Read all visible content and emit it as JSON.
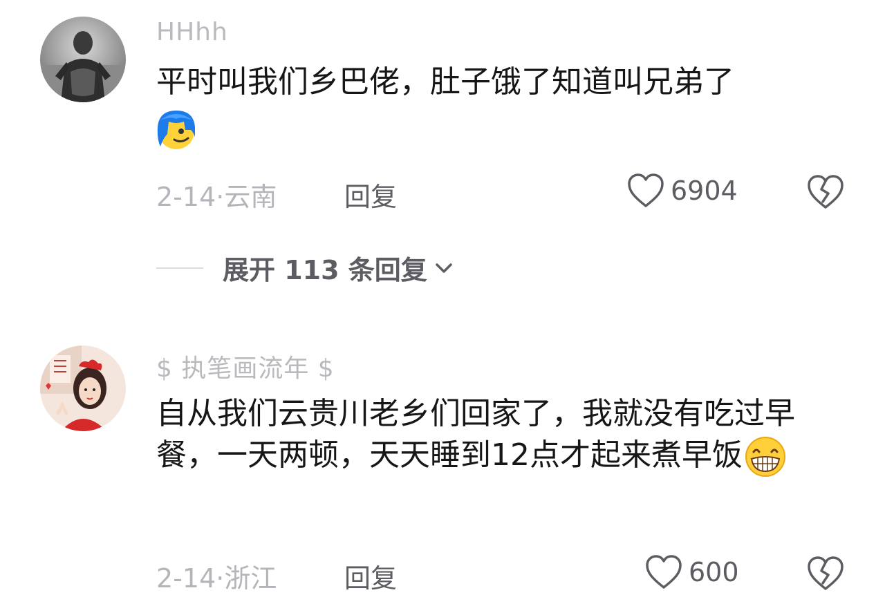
{
  "comments": [
    {
      "username": "HHhh",
      "text": "平时叫我们乡巴佬，肚子饿了知道叫兄弟了",
      "emoji": "blue-hair-smirk-emoji",
      "date_location": "2-14·云南",
      "reply_label": "回复",
      "likes": "6904"
    },
    {
      "username": "$ 执笔画流年 $",
      "text": "自从我们云贵川老乡们回家了，我就没有吃过早餐，一天两顿，天天睡到12点才起来煮早饭",
      "emoji": "grinning-teeth-emoji",
      "date_location": "2-14·浙江",
      "reply_label": "回复",
      "likes": "600"
    }
  ],
  "expand_replies": {
    "label": "展开 113 条回复"
  },
  "colors": {
    "username": "#b9b9be",
    "meta": "#b4b4ba",
    "action": "#5c5c62",
    "text": "#161616"
  }
}
